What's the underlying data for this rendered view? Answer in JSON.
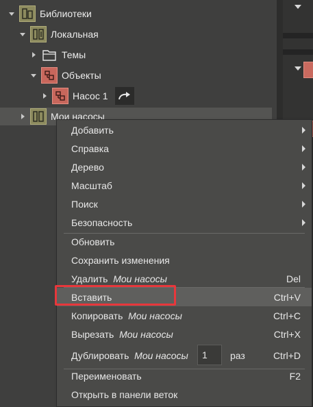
{
  "tree": {
    "root": {
      "label": "Библиотеки",
      "icon": "library-icon"
    },
    "local": {
      "label": "Локальная",
      "icon": "local-library-icon"
    },
    "themes": {
      "label": "Темы",
      "icon": "folder-icon"
    },
    "objects": {
      "label": "Объекты",
      "icon": "objects-icon"
    },
    "pump": {
      "label": "Насос 1",
      "icon": "object-icon",
      "action_icon": "redo-arrow-icon"
    },
    "my_pumps": {
      "label": "Мои насосы",
      "icon": "library-icon"
    }
  },
  "context_menu": {
    "submenus": [
      {
        "label": "Добавить"
      },
      {
        "label": "Справка"
      },
      {
        "label": "Дерево"
      },
      {
        "label": "Масштаб"
      },
      {
        "label": "Поиск"
      },
      {
        "label": "Безопасность"
      }
    ],
    "refresh": {
      "label": "Обновить"
    },
    "save_changes": {
      "label": "Сохранить изменения"
    },
    "delete": {
      "label": "Удалить",
      "target": "Мои насосы",
      "shortcut": "Del"
    },
    "paste": {
      "label": "Вставить",
      "shortcut": "Ctrl+V"
    },
    "copy": {
      "label": "Копировать",
      "target": "Мои насосы",
      "shortcut": "Ctrl+C"
    },
    "cut": {
      "label": "Вырезать",
      "target": "Мои насосы",
      "shortcut": "Ctrl+X"
    },
    "duplicate": {
      "label": "Дублировать",
      "target": "Мои насосы",
      "count": "1",
      "times_label": "раз",
      "shortcut": "Ctrl+D"
    },
    "rename": {
      "label": "Переименовать",
      "shortcut": "F2"
    },
    "open_in_branch_panel": {
      "label": "Открыть в панели веток"
    }
  },
  "colors": {
    "highlight_border": "#e8373b",
    "olive_icon": "#8c8a5e",
    "red_icon": "#c8675c"
  }
}
